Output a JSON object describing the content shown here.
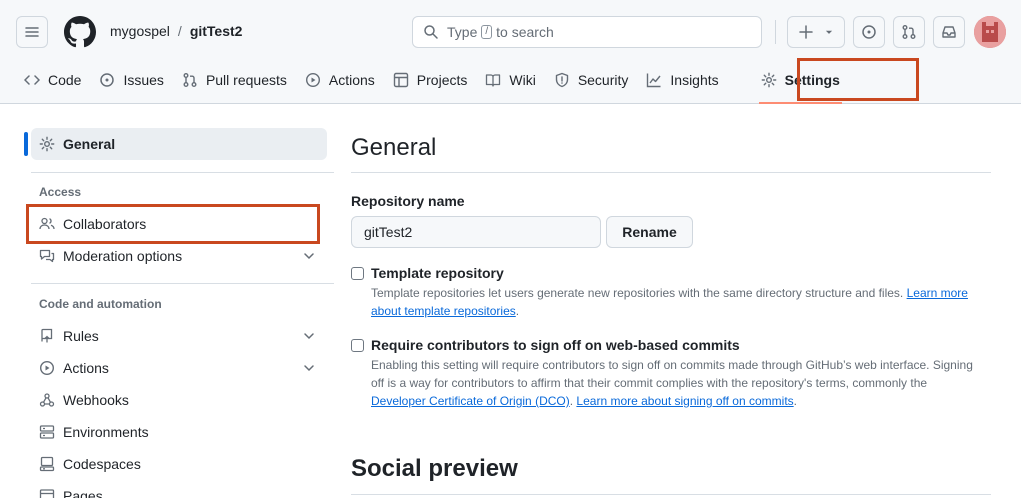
{
  "header": {
    "owner": "mygospel",
    "separator": "/",
    "repo": "gitTest2",
    "search_prefix": "Type",
    "search_key": "/",
    "search_suffix": "to search"
  },
  "tabs": [
    {
      "label": "Code",
      "icon": "code-icon"
    },
    {
      "label": "Issues",
      "icon": "issue-icon"
    },
    {
      "label": "Pull requests",
      "icon": "pull-request-icon"
    },
    {
      "label": "Actions",
      "icon": "play-icon"
    },
    {
      "label": "Projects",
      "icon": "table-icon"
    },
    {
      "label": "Wiki",
      "icon": "book-icon"
    },
    {
      "label": "Security",
      "icon": "shield-icon"
    },
    {
      "label": "Insights",
      "icon": "graph-icon"
    },
    {
      "label": "Settings",
      "icon": "gear-icon",
      "selected": true
    }
  ],
  "sidebar": {
    "general": "General",
    "access_heading": "Access",
    "collaborators": "Collaborators",
    "moderation": "Moderation options",
    "code_heading": "Code and automation",
    "rules": "Rules",
    "actions": "Actions",
    "webhooks": "Webhooks",
    "environments": "Environments",
    "codespaces": "Codespaces",
    "pages": "Pages"
  },
  "main": {
    "title": "General",
    "repo_name_label": "Repository name",
    "repo_name_value": "gitTest2",
    "rename_label": "Rename",
    "template": {
      "title": "Template repository",
      "desc": "Template repositories let users generate new repositories with the same directory structure and files.",
      "link": "Learn more about template repositories",
      "end": "."
    },
    "signoff": {
      "title": "Require contributors to sign off on web-based commits",
      "desc": "Enabling this setting will require contributors to sign off on commits made through GitHub’s web interface. Signing off is a way for contributors to affirm that their commit complies with the repository's terms, commonly the",
      "link1": "Developer Certificate of Origin (DCO)",
      "mid": ".",
      "link2": "Learn more about signing off on commits",
      "end": "."
    },
    "social_title": "Social preview"
  },
  "colors": {
    "accent": "#0969da",
    "highlight": "#c9481f",
    "tab_underline": "#fd8c73"
  }
}
